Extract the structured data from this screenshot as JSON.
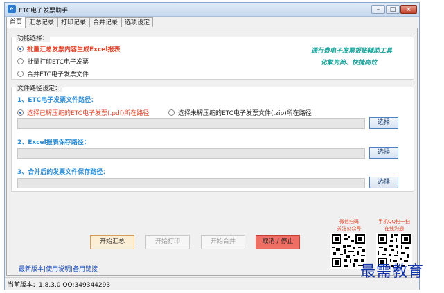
{
  "window": {
    "title": "ETC电子发票助手",
    "min_label": "–",
    "max_label": "□",
    "close_label": "×"
  },
  "tabs": [
    {
      "label": "首页"
    },
    {
      "label": "汇总记录"
    },
    {
      "label": "打印记录"
    },
    {
      "label": "合并记录"
    },
    {
      "label": "选项设定"
    }
  ],
  "function_group": {
    "title": "功能选择：",
    "options": [
      {
        "label": "批量汇总发票内容生成Excel报表",
        "checked": true
      },
      {
        "label": "批量打印ETC电子发票",
        "checked": false
      },
      {
        "label": "合并ETC电子发票文件",
        "checked": false
      }
    ],
    "slogan_line1": "通行费电子发票报账辅助工具",
    "slogan_line2": "化繁为简、快捷高效"
  },
  "path_group": {
    "title": "文件路径设定：",
    "sections": [
      {
        "title": "1、ETC电子发票文件路径：",
        "button": "选择",
        "value": ""
      },
      {
        "title": "2、Excel报表保存路径：",
        "button": "选择",
        "value": ""
      },
      {
        "title": "3、合并后的发票文件保存路径：",
        "button": "选择",
        "value": ""
      }
    ],
    "source_options": [
      {
        "label": "选择已解压缩的ETC电子发票(.pdf)所在路径",
        "checked": true
      },
      {
        "label": "选择未解压缩的ETC电子发票文件(.zip)所在路径",
        "checked": false
      }
    ]
  },
  "actions": {
    "summary": "开始汇总",
    "print": "开始打印",
    "merge": "开始合并",
    "cancel": "取消 / 停止"
  },
  "qr": [
    {
      "line1": "微信扫码",
      "line2": "关注公众号"
    },
    {
      "line1": "手机QQ扫一扫",
      "line2": "在线沟通"
    }
  ],
  "links": {
    "latest": "最新版本",
    "sep1": "|",
    "help": "使用说明",
    "sep2": "|",
    "backup": "备用链接"
  },
  "status": {
    "text": "当前版本：1.8.3.0   QQ:349344293"
  },
  "watermark": "最需教育"
}
